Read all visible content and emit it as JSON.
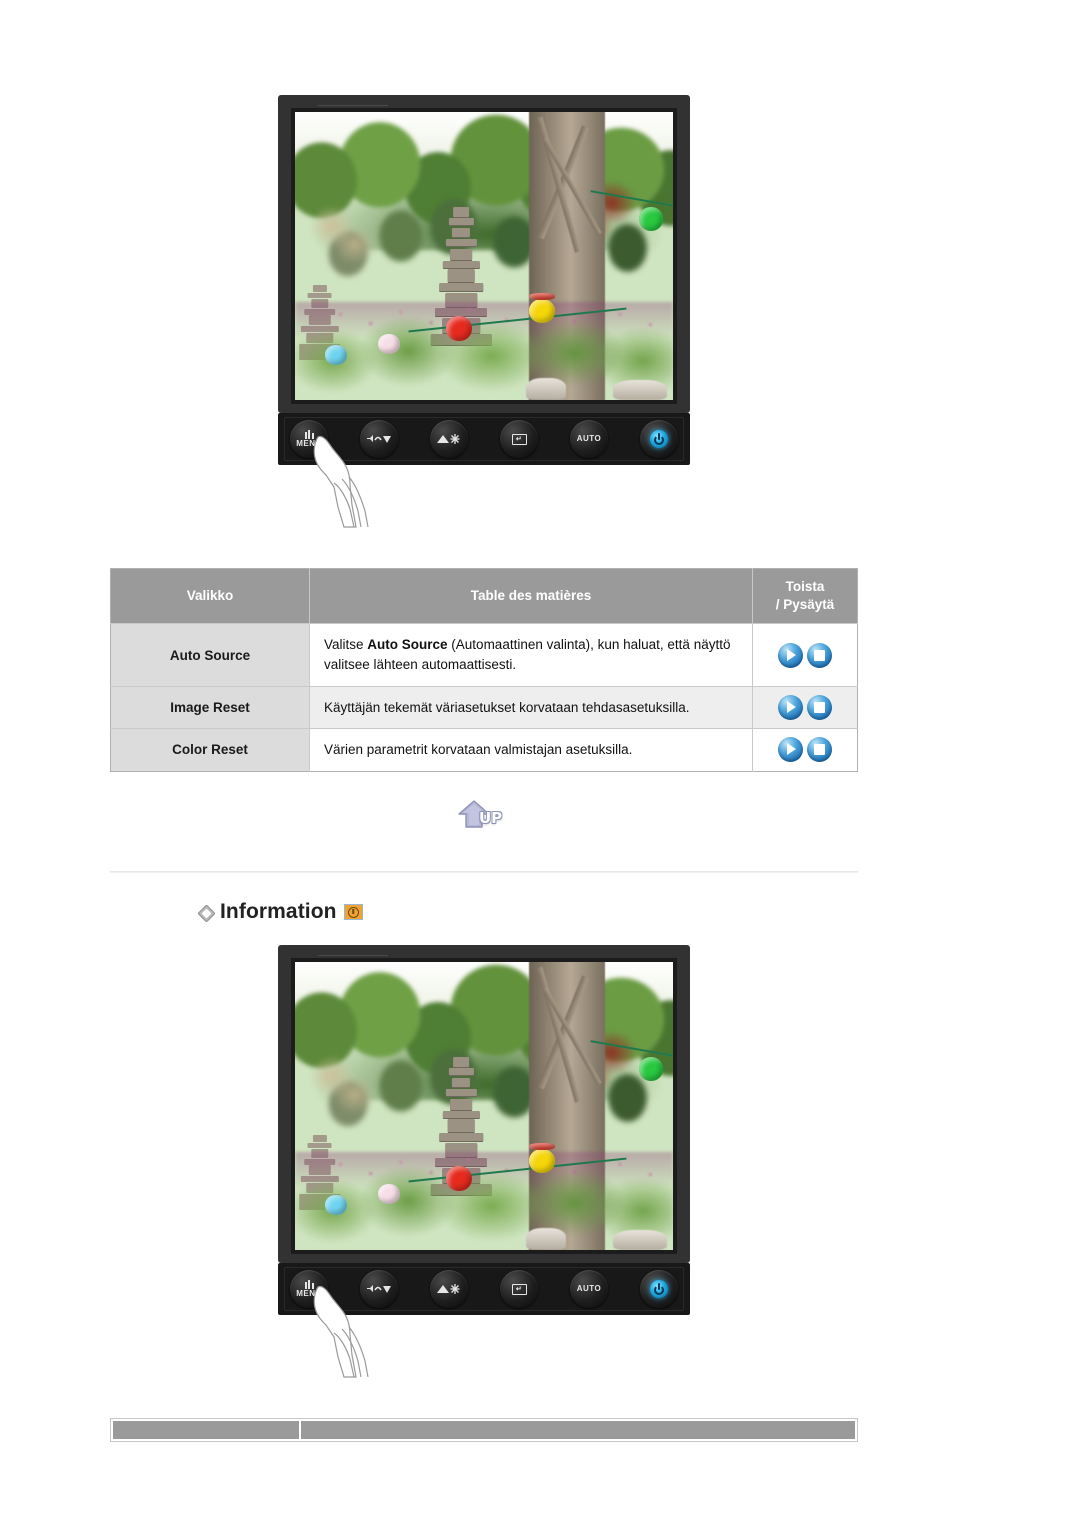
{
  "page": {
    "language": "Finnish",
    "background_color": "#ffffff"
  },
  "monitor_top": {
    "name": "Samsung LCD monitor front view",
    "photo_description": "Korean garden with stone pagoda, trees and colored paper lanterns",
    "controls": [
      {
        "id": "menu",
        "label": "MENU",
        "icon": "menu-icon"
      },
      {
        "id": "down",
        "label": "",
        "icon": "volume-down-icon"
      },
      {
        "id": "brightness",
        "label": "",
        "icon": "brightness-icon"
      },
      {
        "id": "enter",
        "label": "",
        "icon": "enter-icon"
      },
      {
        "id": "auto",
        "label": "AUTO",
        "icon": "auto-icon"
      },
      {
        "id": "power",
        "label": "",
        "icon": "power-icon"
      }
    ],
    "pointer": "hand-pointing-at-menu-button"
  },
  "menu_table": {
    "headers": {
      "col1": "Valikko",
      "col2": "Table des matières",
      "col3_line1": "Toista",
      "col3_line2": "/ Pysäytä"
    },
    "rows": [
      {
        "label": "Auto Source",
        "desc_pre": "Valitse ",
        "desc_bold": "Auto Source",
        "desc_post": " (Automaattinen valinta), kun haluat, että näyttö valitsee lähteen automaattisesti.",
        "play_icon": "play-icon",
        "stop_icon": "stop-icon"
      },
      {
        "label": "Image Reset",
        "desc_pre": "Käyttäjän tekemät väriasetukset korvataan tehdasasetuksilla.",
        "desc_bold": "",
        "desc_post": "",
        "play_icon": "play-icon",
        "stop_icon": "stop-icon"
      },
      {
        "label": "Color Reset",
        "desc_pre": "Värien parametrit korvataan valmistajan asetuksilla.",
        "desc_bold": "",
        "desc_post": "",
        "play_icon": "play-icon",
        "stop_icon": "stop-icon"
      }
    ],
    "header_bg": "#9a9a9a",
    "label_bg": "#dcdcdc"
  },
  "up_button": {
    "label": "UP",
    "icon": "up-arrow-icon",
    "color": "#b3b6d6"
  },
  "information_section": {
    "bullet": "diamond-bullet-icon",
    "title": "Information",
    "icon": "information-orange-icon",
    "icon_color": "#f0a230"
  },
  "monitor_bottom": {
    "name": "Samsung LCD monitor front view",
    "photo_description": "Korean garden with stone pagoda, trees and colored paper lanterns",
    "controls": [
      {
        "id": "menu",
        "label": "MENU",
        "icon": "menu-icon"
      },
      {
        "id": "down",
        "label": "",
        "icon": "volume-down-icon"
      },
      {
        "id": "brightness",
        "label": "",
        "icon": "brightness-icon"
      },
      {
        "id": "enter",
        "label": "",
        "icon": "enter-icon"
      },
      {
        "id": "auto",
        "label": "AUTO",
        "icon": "auto-icon"
      },
      {
        "id": "power",
        "label": "",
        "icon": "power-icon"
      }
    ],
    "pointer": "hand-pointing-at-menu-button"
  },
  "bottom_table": {
    "cells": [
      "",
      ""
    ],
    "bg": "#9a9a9a"
  }
}
